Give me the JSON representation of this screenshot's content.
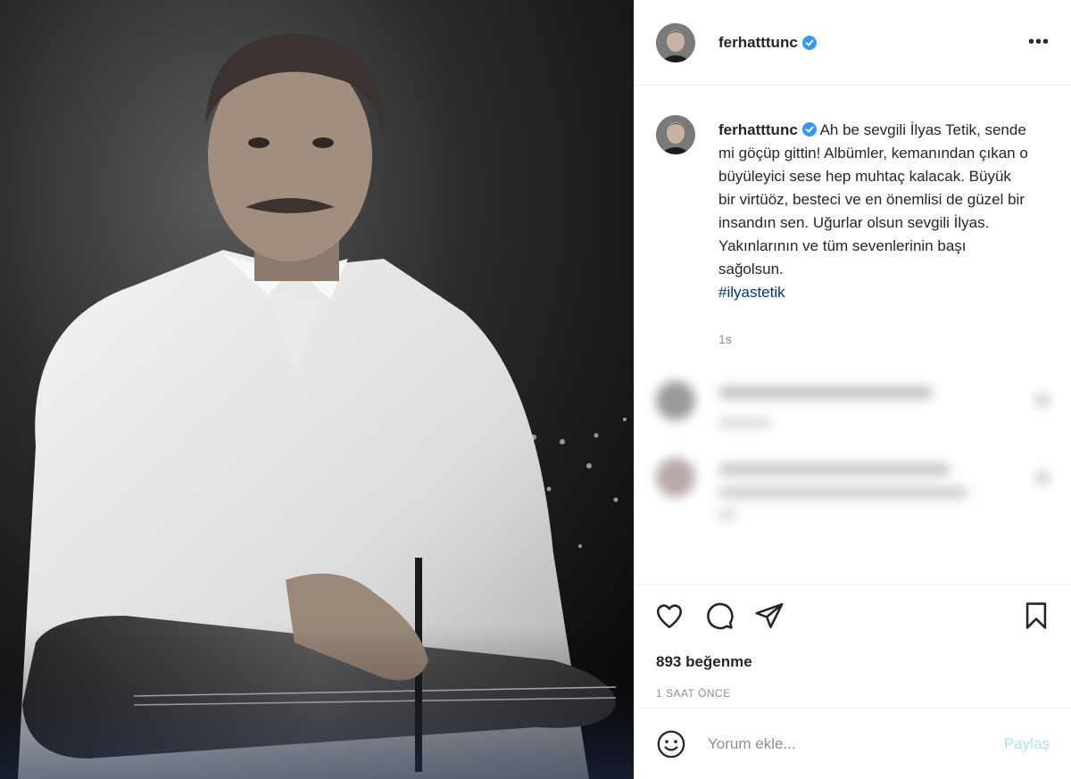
{
  "header": {
    "username": "ferhatttunc",
    "verified": true,
    "more_icon": "more-horizontal-icon"
  },
  "caption": {
    "username": "ferhatttunc",
    "text": "Ah be sevgili İlyas Tetik, sende mi göçüp gittin! Albümler, kemanından çıkan o büyüleyici sese hep muhtaç kalacak. Büyük bir virtüöz, besteci ve en önemlisi de güzel bir insandın sen. Uğurlar olsun sevgili İlyas. Yakınlarının ve tüm sevenlerinin başı sağolsun.",
    "hashtag": "#ilyastetik",
    "time": "1s"
  },
  "actions": {
    "like_icon": "heart-icon",
    "comment_icon": "comment-icon",
    "share_icon": "send-icon",
    "save_icon": "bookmark-icon"
  },
  "likes_text": "893 beğenme",
  "posted_ago": "1 SAAT ÖNCE",
  "add_comment": {
    "placeholder": "Yorum ekle...",
    "post_label": "Paylaş",
    "emoji_icon": "smiley-icon"
  },
  "colors": {
    "verified_blue": "#3897f0",
    "hashtag": "#00376b",
    "muted": "#8e8e8e",
    "post_button_disabled": "#b2dffc"
  }
}
